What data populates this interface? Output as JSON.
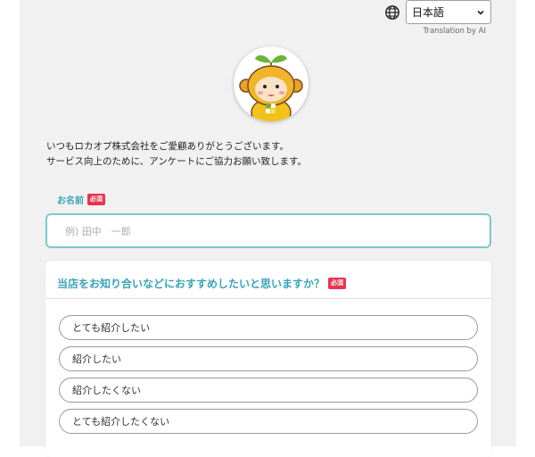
{
  "language": {
    "selected": "日本語",
    "translation_note": "Translation by AI"
  },
  "intro": {
    "line1": "いつもロカオプ株式会社をご愛顧ありがとうございます。",
    "line2": "サービス向上のために、アンケートにご協力お願い致します。"
  },
  "name_field": {
    "label": "お名前",
    "required": "必須",
    "placeholder": "例) 田中　一郎"
  },
  "question": {
    "title": "当店をお知り合いなどにおすすめしたいと思いますか？",
    "required": "必須",
    "options": [
      "とても紹介したい",
      "紹介したい",
      "紹介したくない",
      "とても紹介したくない"
    ]
  },
  "colors": {
    "accent": "#3aa3b8",
    "required_badge": "#e8344e",
    "input_border": "#7cc8d0"
  },
  "icons": [
    "globe-icon",
    "chevron-down-icon",
    "mascot-logo"
  ]
}
